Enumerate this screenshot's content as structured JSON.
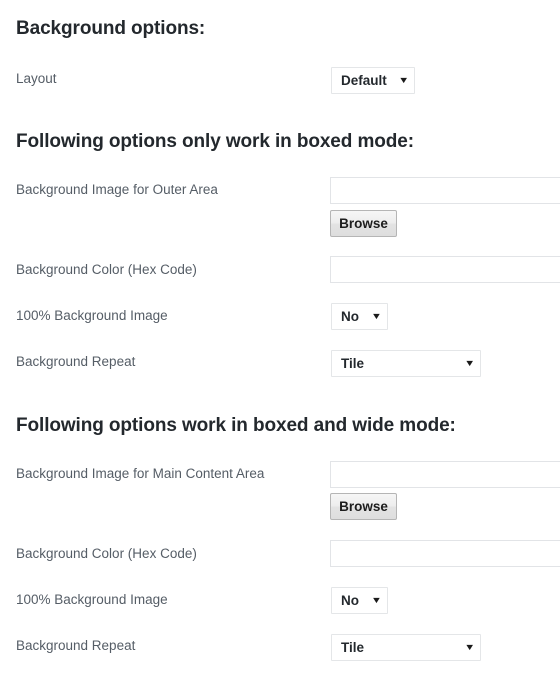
{
  "sections": [
    {
      "heading": "Background options:",
      "fields": [
        {
          "label": "Layout",
          "control": "select",
          "value": "Default",
          "arrow": "▼"
        }
      ]
    },
    {
      "heading": "Following options only work in boxed mode:",
      "fields": [
        {
          "label": "Background Image for Outer Area",
          "control": "upload",
          "value": "",
          "placeholder": "",
          "button_label": "Browse"
        },
        {
          "label": "Background Color (Hex Code)",
          "control": "text",
          "value": "",
          "placeholder": ""
        },
        {
          "label": "100% Background Image",
          "control": "select",
          "value": "No",
          "arrow": "▼"
        },
        {
          "label": "Background Repeat",
          "control": "select",
          "value": "Tile",
          "arrow": "▼"
        }
      ]
    },
    {
      "heading": "Following options work in boxed and wide mode:",
      "fields": [
        {
          "label": "Background Image for Main Content Area",
          "control": "upload",
          "value": "",
          "placeholder": "",
          "button_label": "Browse"
        },
        {
          "label": "Background Color (Hex Code)",
          "control": "text",
          "value": "",
          "placeholder": ""
        },
        {
          "label": "100% Background Image",
          "control": "select",
          "value": "No",
          "arrow": "▼"
        },
        {
          "label": "Background Repeat",
          "control": "select",
          "value": "Tile",
          "arrow": "▼"
        }
      ]
    }
  ],
  "colors": {
    "page_background": "#ffffff",
    "heading_text": "#23282d",
    "label_text": "#555d66",
    "input_border": "#e2e4e7",
    "button_border": "#b5b5b5",
    "button_face": "#ededed"
  }
}
